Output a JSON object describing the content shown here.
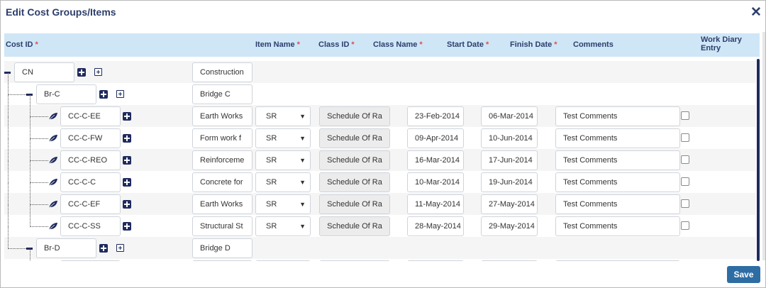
{
  "dialog": {
    "title": "Edit Cost Groups/Items",
    "close_glyph": "✕"
  },
  "columns": {
    "cost_id": "Cost ID",
    "item_name": "Item Name",
    "class_id": "Class ID",
    "class_name": "Class Name",
    "start_date": "Start Date",
    "finish_date": "Finish Date",
    "comments": "Comments",
    "work_diary_entry": "Work Diary Entry",
    "required_mark": "*"
  },
  "groups": {
    "root": {
      "cost_id": "CN",
      "item_name": "Construction"
    },
    "brc": {
      "cost_id": "Br-C",
      "item_name": "Bridge  C"
    },
    "brd": {
      "cost_id": "Br-D",
      "item_name": "Bridge  D"
    }
  },
  "items": [
    {
      "cost_id": "CC-C-EE",
      "item_name": "Earth Works",
      "class_id": "SR",
      "class_name": "Schedule Of Ra",
      "start_date": "23-Feb-2014",
      "finish_date": "06-Mar-2014",
      "comments": "Test Comments",
      "work_diary_entry": false
    },
    {
      "cost_id": "CC-C-FW",
      "item_name": "Form work f",
      "class_id": "SR",
      "class_name": "Schedule Of Ra",
      "start_date": "09-Apr-2014",
      "finish_date": "10-Jun-2014",
      "comments": "Test Comments",
      "work_diary_entry": false
    },
    {
      "cost_id": "CC-C-REO",
      "item_name": "Reinforceme",
      "class_id": "SR",
      "class_name": "Schedule Of Ra",
      "start_date": "16-Mar-2014",
      "finish_date": "17-Jun-2014",
      "comments": "Test Comments",
      "work_diary_entry": false
    },
    {
      "cost_id": "CC-C-C",
      "item_name": "Concrete for",
      "class_id": "SR",
      "class_name": "Schedule Of Ra",
      "start_date": "10-Mar-2014",
      "finish_date": "19-Jun-2014",
      "comments": "Test Comments",
      "work_diary_entry": false
    },
    {
      "cost_id": "CC-C-EF",
      "item_name": "Earth Works",
      "class_id": "SR",
      "class_name": "Schedule Of Ra",
      "start_date": "11-May-2014",
      "finish_date": "27-May-2014",
      "comments": "Test Comments",
      "work_diary_entry": false
    },
    {
      "cost_id": "CC-C-SS",
      "item_name": "Structural St",
      "class_id": "SR",
      "class_name": "Schedule Of Ra",
      "start_date": "28-May-2014",
      "finish_date": "29-May-2014",
      "comments": "Test Comments",
      "work_diary_entry": false
    }
  ],
  "footer": {
    "save_label": "Save"
  },
  "colors": {
    "header_bg": "#cfe6f7",
    "accent": "#1f2b5e",
    "save_bg": "#2e6da4",
    "required": "#d9534f"
  }
}
